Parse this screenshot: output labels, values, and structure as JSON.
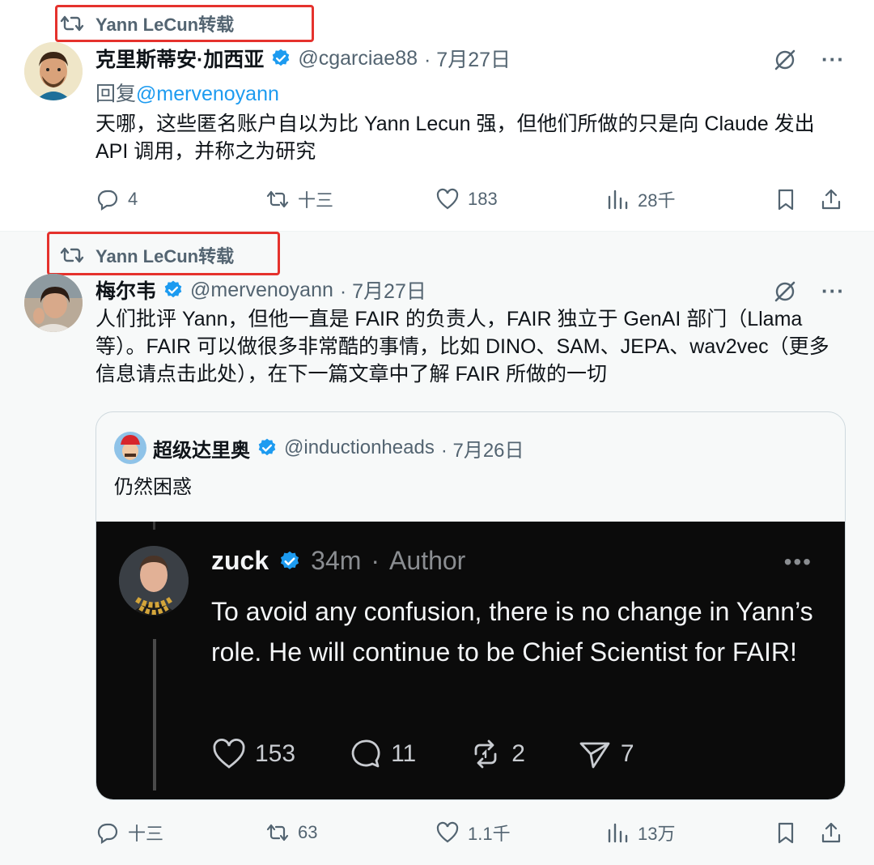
{
  "tweet1": {
    "repost_label": "Yann LeCun转载",
    "author_name": "克里斯蒂安·加西亚",
    "handle": "@cgarciae88",
    "date": "· 7月27日",
    "reply_prefix": "回复",
    "reply_handle": "@mervenoyann",
    "text": "天哪，这些匿名账户自以为比 Yann Lecun 强，但他们所做的只是向 Claude 发出 API 调用，并称之为研究",
    "stats": {
      "replies": "4",
      "reposts": "十三",
      "likes": "183",
      "views": "28千"
    }
  },
  "tweet2": {
    "repost_label": "Yann LeCun转载",
    "author_name": "梅尔韦",
    "handle": "@mervenoyann",
    "date": "· 7月27日",
    "text": "人们批评 Yann，但他一直是 FAIR 的负责人，FAIR 独立于 GenAI 部门（Llama 等）。FAIR 可以做很多非常酷的事情，比如 DINO、SAM、JEPA、wav2vec（更多信息请点击此处），在下一篇文章中了解 FAIR 所做的一切",
    "stats": {
      "replies": "十三",
      "reposts": "63",
      "likes": "1.1千",
      "views": "13万"
    },
    "quote": {
      "author_name": "超级达里奥",
      "handle": "@inductionheads",
      "date": "· 7月26日",
      "text": "仍然困惑",
      "screenshot": {
        "name": "zuck",
        "time": "34m",
        "sep": "·",
        "role": "Author",
        "text": "To avoid any confusion, there is no change in Yann’s role. He will continue to be Chief Scientist for FAIR!",
        "likes": "153",
        "comments": "11",
        "reposts": "2",
        "shares": "7"
      }
    }
  },
  "colors": {
    "accent": "#1d9bf0",
    "highlight": "#e5322d",
    "muted": "#536471"
  }
}
